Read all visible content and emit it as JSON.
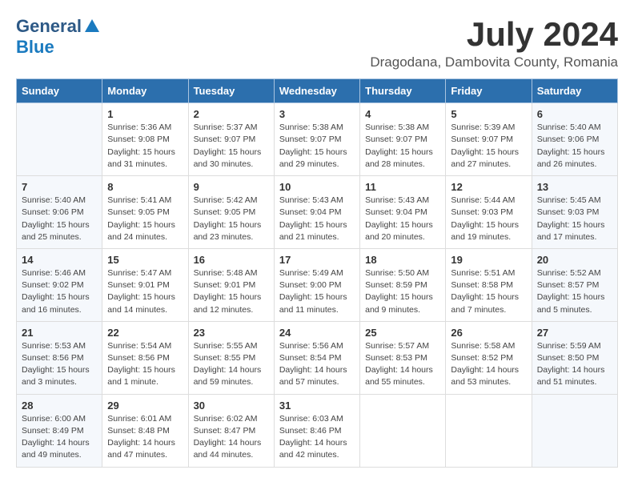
{
  "logo": {
    "general": "General",
    "blue": "Blue"
  },
  "title": "July 2024",
  "location": "Dragodana, Dambovita County, Romania",
  "weekdays": [
    "Sunday",
    "Monday",
    "Tuesday",
    "Wednesday",
    "Thursday",
    "Friday",
    "Saturday"
  ],
  "weeks": [
    [
      {
        "day": "",
        "sunrise": "",
        "sunset": "",
        "daylight": ""
      },
      {
        "day": "1",
        "sunrise": "Sunrise: 5:36 AM",
        "sunset": "Sunset: 9:08 PM",
        "daylight": "Daylight: 15 hours and 31 minutes."
      },
      {
        "day": "2",
        "sunrise": "Sunrise: 5:37 AM",
        "sunset": "Sunset: 9:07 PM",
        "daylight": "Daylight: 15 hours and 30 minutes."
      },
      {
        "day": "3",
        "sunrise": "Sunrise: 5:38 AM",
        "sunset": "Sunset: 9:07 PM",
        "daylight": "Daylight: 15 hours and 29 minutes."
      },
      {
        "day": "4",
        "sunrise": "Sunrise: 5:38 AM",
        "sunset": "Sunset: 9:07 PM",
        "daylight": "Daylight: 15 hours and 28 minutes."
      },
      {
        "day": "5",
        "sunrise": "Sunrise: 5:39 AM",
        "sunset": "Sunset: 9:07 PM",
        "daylight": "Daylight: 15 hours and 27 minutes."
      },
      {
        "day": "6",
        "sunrise": "Sunrise: 5:40 AM",
        "sunset": "Sunset: 9:06 PM",
        "daylight": "Daylight: 15 hours and 26 minutes."
      }
    ],
    [
      {
        "day": "7",
        "sunrise": "Sunrise: 5:40 AM",
        "sunset": "Sunset: 9:06 PM",
        "daylight": "Daylight: 15 hours and 25 minutes."
      },
      {
        "day": "8",
        "sunrise": "Sunrise: 5:41 AM",
        "sunset": "Sunset: 9:05 PM",
        "daylight": "Daylight: 15 hours and 24 minutes."
      },
      {
        "day": "9",
        "sunrise": "Sunrise: 5:42 AM",
        "sunset": "Sunset: 9:05 PM",
        "daylight": "Daylight: 15 hours and 23 minutes."
      },
      {
        "day": "10",
        "sunrise": "Sunrise: 5:43 AM",
        "sunset": "Sunset: 9:04 PM",
        "daylight": "Daylight: 15 hours and 21 minutes."
      },
      {
        "day": "11",
        "sunrise": "Sunrise: 5:43 AM",
        "sunset": "Sunset: 9:04 PM",
        "daylight": "Daylight: 15 hours and 20 minutes."
      },
      {
        "day": "12",
        "sunrise": "Sunrise: 5:44 AM",
        "sunset": "Sunset: 9:03 PM",
        "daylight": "Daylight: 15 hours and 19 minutes."
      },
      {
        "day": "13",
        "sunrise": "Sunrise: 5:45 AM",
        "sunset": "Sunset: 9:03 PM",
        "daylight": "Daylight: 15 hours and 17 minutes."
      }
    ],
    [
      {
        "day": "14",
        "sunrise": "Sunrise: 5:46 AM",
        "sunset": "Sunset: 9:02 PM",
        "daylight": "Daylight: 15 hours and 16 minutes."
      },
      {
        "day": "15",
        "sunrise": "Sunrise: 5:47 AM",
        "sunset": "Sunset: 9:01 PM",
        "daylight": "Daylight: 15 hours and 14 minutes."
      },
      {
        "day": "16",
        "sunrise": "Sunrise: 5:48 AM",
        "sunset": "Sunset: 9:01 PM",
        "daylight": "Daylight: 15 hours and 12 minutes."
      },
      {
        "day": "17",
        "sunrise": "Sunrise: 5:49 AM",
        "sunset": "Sunset: 9:00 PM",
        "daylight": "Daylight: 15 hours and 11 minutes."
      },
      {
        "day": "18",
        "sunrise": "Sunrise: 5:50 AM",
        "sunset": "Sunset: 8:59 PM",
        "daylight": "Daylight: 15 hours and 9 minutes."
      },
      {
        "day": "19",
        "sunrise": "Sunrise: 5:51 AM",
        "sunset": "Sunset: 8:58 PM",
        "daylight": "Daylight: 15 hours and 7 minutes."
      },
      {
        "day": "20",
        "sunrise": "Sunrise: 5:52 AM",
        "sunset": "Sunset: 8:57 PM",
        "daylight": "Daylight: 15 hours and 5 minutes."
      }
    ],
    [
      {
        "day": "21",
        "sunrise": "Sunrise: 5:53 AM",
        "sunset": "Sunset: 8:56 PM",
        "daylight": "Daylight: 15 hours and 3 minutes."
      },
      {
        "day": "22",
        "sunrise": "Sunrise: 5:54 AM",
        "sunset": "Sunset: 8:56 PM",
        "daylight": "Daylight: 15 hours and 1 minute."
      },
      {
        "day": "23",
        "sunrise": "Sunrise: 5:55 AM",
        "sunset": "Sunset: 8:55 PM",
        "daylight": "Daylight: 14 hours and 59 minutes."
      },
      {
        "day": "24",
        "sunrise": "Sunrise: 5:56 AM",
        "sunset": "Sunset: 8:54 PM",
        "daylight": "Daylight: 14 hours and 57 minutes."
      },
      {
        "day": "25",
        "sunrise": "Sunrise: 5:57 AM",
        "sunset": "Sunset: 8:53 PM",
        "daylight": "Daylight: 14 hours and 55 minutes."
      },
      {
        "day": "26",
        "sunrise": "Sunrise: 5:58 AM",
        "sunset": "Sunset: 8:52 PM",
        "daylight": "Daylight: 14 hours and 53 minutes."
      },
      {
        "day": "27",
        "sunrise": "Sunrise: 5:59 AM",
        "sunset": "Sunset: 8:50 PM",
        "daylight": "Daylight: 14 hours and 51 minutes."
      }
    ],
    [
      {
        "day": "28",
        "sunrise": "Sunrise: 6:00 AM",
        "sunset": "Sunset: 8:49 PM",
        "daylight": "Daylight: 14 hours and 49 minutes."
      },
      {
        "day": "29",
        "sunrise": "Sunrise: 6:01 AM",
        "sunset": "Sunset: 8:48 PM",
        "daylight": "Daylight: 14 hours and 47 minutes."
      },
      {
        "day": "30",
        "sunrise": "Sunrise: 6:02 AM",
        "sunset": "Sunset: 8:47 PM",
        "daylight": "Daylight: 14 hours and 44 minutes."
      },
      {
        "day": "31",
        "sunrise": "Sunrise: 6:03 AM",
        "sunset": "Sunset: 8:46 PM",
        "daylight": "Daylight: 14 hours and 42 minutes."
      },
      {
        "day": "",
        "sunrise": "",
        "sunset": "",
        "daylight": ""
      },
      {
        "day": "",
        "sunrise": "",
        "sunset": "",
        "daylight": ""
      },
      {
        "day": "",
        "sunrise": "",
        "sunset": "",
        "daylight": ""
      }
    ]
  ]
}
